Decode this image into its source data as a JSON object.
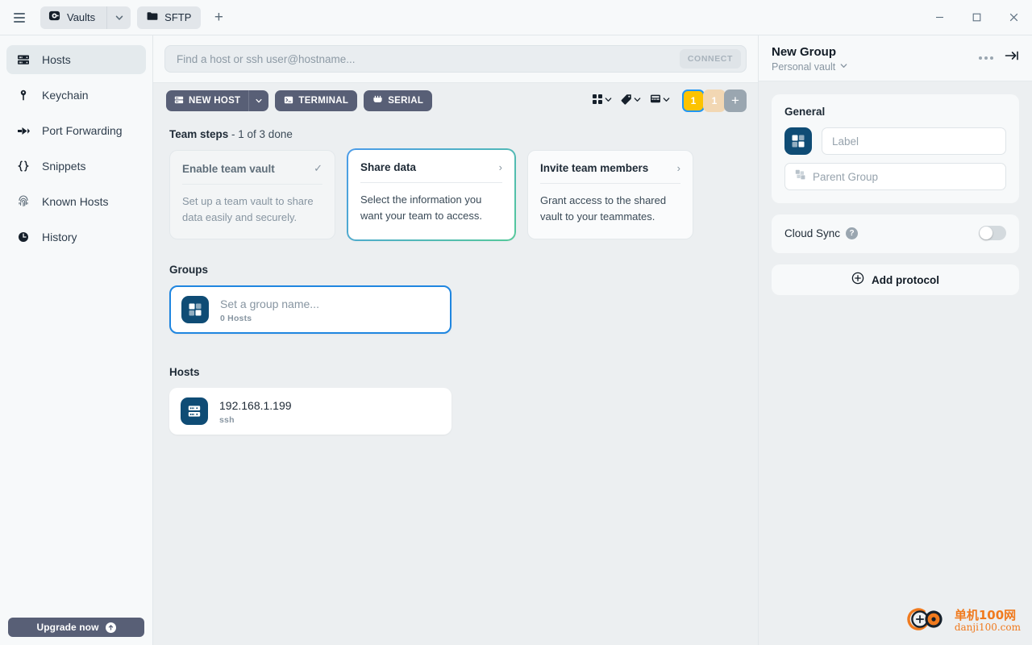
{
  "titlebar": {
    "vault_tab_label": "Vaults",
    "vault_icon": "vault-dial-icon",
    "sftp_tab_label": "SFTP",
    "sftp_icon": "folder-icon",
    "new_tab_label": "+",
    "minimize_label": "–",
    "maximize_label": "□",
    "close_label": "✕"
  },
  "sidebar": {
    "items": [
      {
        "label": "Hosts",
        "icon": "server-rack-icon",
        "active": true
      },
      {
        "label": "Keychain",
        "icon": "key-icon",
        "active": false
      },
      {
        "label": "Port Forwarding",
        "icon": "arrow-forward-icon",
        "active": false
      },
      {
        "label": "Snippets",
        "icon": "curly-braces-icon",
        "active": false
      },
      {
        "label": "Known Hosts",
        "icon": "fingerprint-icon",
        "active": false
      },
      {
        "label": "History",
        "icon": "clock-icon",
        "active": false
      }
    ],
    "upgrade_label": "Upgrade now",
    "upgrade_icon": "arrow-up-circle-icon"
  },
  "search": {
    "placeholder": "Find a host or ssh user@hostname...",
    "value": "",
    "connect_label": "CONNECT"
  },
  "toolbar": {
    "new_host_label": "NEW HOST",
    "new_host_icon": "server-icon",
    "new_host_caret": "chevron-down-icon",
    "terminal_label": "TERMINAL",
    "terminal_icon": "terminal-icon",
    "serial_label": "SERIAL",
    "serial_icon": "serial-plug-icon",
    "view_grid_icon": "grid-view-icon",
    "tag_icon": "tag-icon",
    "columns_icon": "table-columns-icon",
    "pills": [
      {
        "label": "1",
        "name": "vault-count-pill-selected",
        "color": "#fdc300"
      },
      {
        "label": "1",
        "name": "vault-count-pill",
        "color": "#f2d7b3"
      },
      {
        "label": "+",
        "name": "add-vault-pill",
        "color": "#9aa6b0"
      }
    ]
  },
  "team_steps": {
    "title_bold": "Team steps",
    "title_rest": " - 1 of 3 done",
    "cards": [
      {
        "title": "Enable team vault",
        "desc": "Set up a team vault to share data easily and securely.",
        "marker": "✓",
        "state": "done"
      },
      {
        "title": "Share data",
        "desc": "Select the information you want your team to access.",
        "marker": "›",
        "state": "active"
      },
      {
        "title": "Invite team members",
        "desc": "Grant access to the shared vault to your teammates.",
        "marker": "›",
        "state": "default"
      }
    ]
  },
  "groups": {
    "heading": "Groups",
    "items": [
      {
        "title": "Set a group name...",
        "sub": "0 Hosts",
        "icon": "group-blocks-icon",
        "selected": true
      }
    ]
  },
  "hosts": {
    "heading": "Hosts",
    "items": [
      {
        "title": "192.168.1.199",
        "sub": "ssh",
        "icon": "server-rack-icon",
        "selected": false
      }
    ]
  },
  "right_panel": {
    "title": "New Group",
    "vault_name": "Personal vault",
    "vault_caret": "chevron-down-icon",
    "more_icon": "more-dots-icon",
    "collapse_icon": "collapse-panel-icon",
    "general": {
      "heading": "General",
      "icon": "group-blocks-icon",
      "label_placeholder": "Label",
      "label_value": "",
      "parent_placeholder": "Parent Group",
      "parent_value": "",
      "parent_icon": "group-small-icon"
    },
    "cloud_sync": {
      "label": "Cloud Sync",
      "help": "?",
      "enabled": false
    },
    "add_protocol": {
      "label": "Add protocol",
      "icon": "plus-circle-icon"
    }
  },
  "watermark": {
    "top": "单机100网",
    "bottom": "danji100.com"
  },
  "colors": {
    "accent_blue": "#1f86e0",
    "icon_blue": "#0f4c75",
    "dark_button": "#585f76",
    "yellow_pill": "#fdc300",
    "app_bg": "#eceff1",
    "panel_bg": "#f7f9fa"
  }
}
